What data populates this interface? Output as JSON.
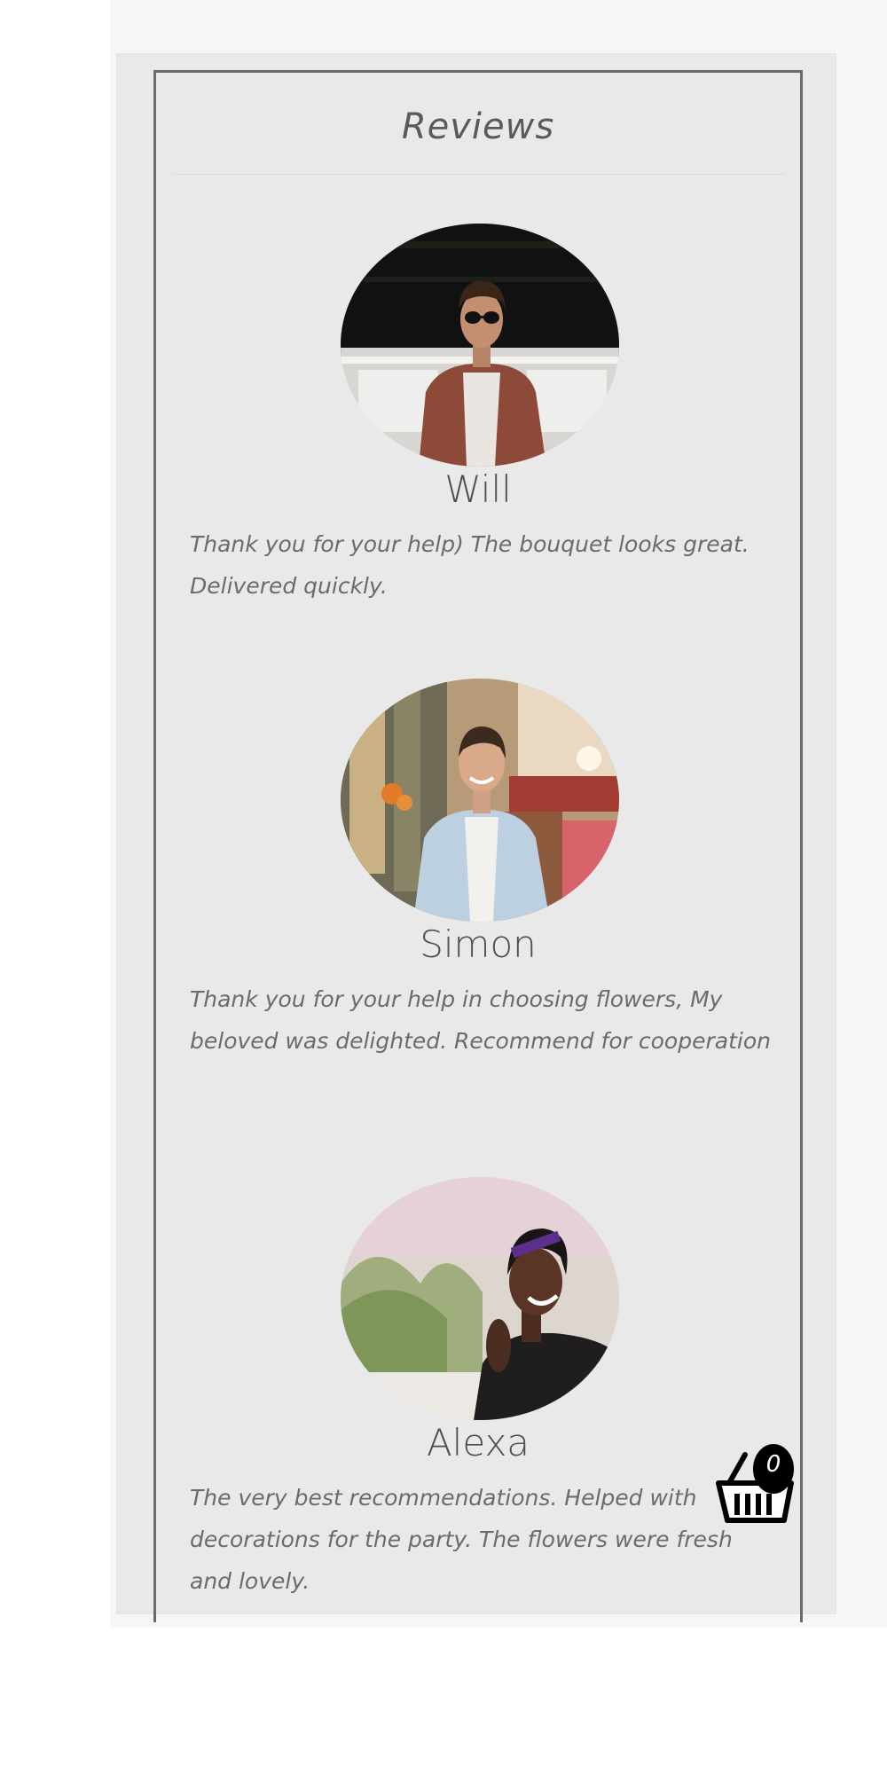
{
  "reviews_section": {
    "title": "Reviews",
    "items": [
      {
        "name": "Will",
        "text": "Thank you for your help) The bouquet looks great. Delivered quickly."
      },
      {
        "name": "Simon",
        "text": "Thank you for your help in choosing flowers, My beloved was delighted. Recommend for cooperation"
      },
      {
        "name": "Alexa",
        "text": "The very best recommendations. Helped with decorations for the party. The flowers were fresh and lovely."
      }
    ]
  },
  "cart": {
    "icon": "basket-icon",
    "count": "0"
  }
}
